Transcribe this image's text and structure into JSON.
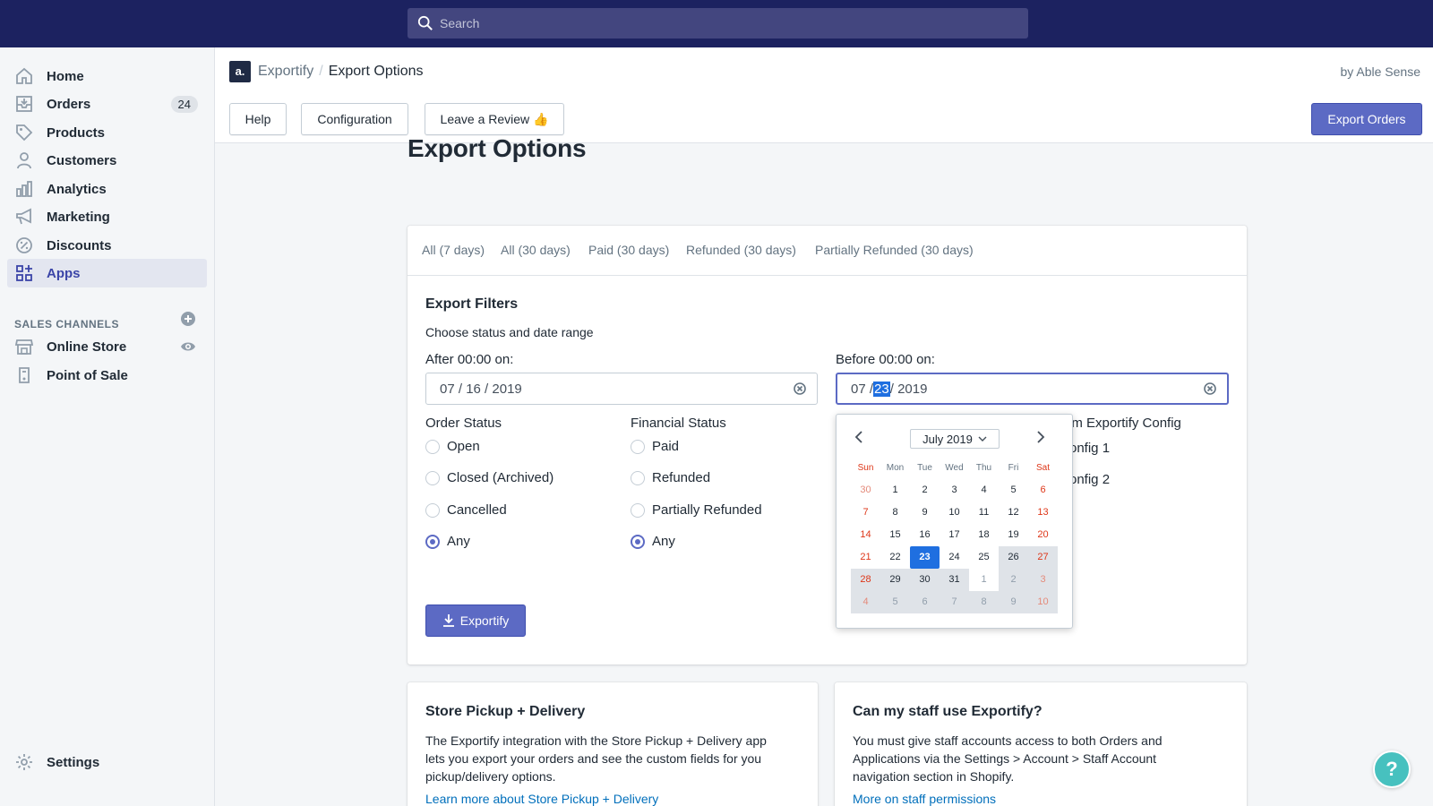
{
  "search": {
    "placeholder": "Search"
  },
  "sidebar": {
    "items": [
      {
        "label": "Home"
      },
      {
        "label": "Orders",
        "badge": "24"
      },
      {
        "label": "Products"
      },
      {
        "label": "Customers"
      },
      {
        "label": "Analytics"
      },
      {
        "label": "Marketing"
      },
      {
        "label": "Discounts"
      },
      {
        "label": "Apps"
      }
    ],
    "sales_channels_title": "SALES CHANNELS",
    "channels": [
      {
        "label": "Online Store"
      },
      {
        "label": "Point of Sale"
      }
    ],
    "settings_label": "Settings"
  },
  "app": {
    "logo": "a.",
    "breadcrumb_app": "Exportify",
    "breadcrumb_sep": "/",
    "breadcrumb_page": "Export Options",
    "byline": "by Able Sense",
    "buttons": {
      "help": "Help",
      "configuration": "Configuration",
      "review": "Leave a Review 👍",
      "export_orders": "Export Orders"
    }
  },
  "page": {
    "title": "Export Options",
    "tabs": [
      "All (7 days)",
      "All (30 days)",
      "Paid (30 days)",
      "Refunded (30 days)",
      "Partially Refunded (30 days)"
    ],
    "filters": {
      "title": "Export Filters",
      "subtitle": "Choose status and date range",
      "after_label": "After 00:00 on:",
      "after_value": {
        "m": "07",
        "d": "16",
        "y": "2019"
      },
      "before_label": "Before 00:00 on:",
      "before_value": {
        "m": "07",
        "d": "23",
        "y": "2019"
      },
      "order_status_title": "Order Status",
      "order_status": [
        "Open",
        "Closed (Archived)",
        "Cancelled",
        "Any"
      ],
      "order_status_selected": "Any",
      "financial_status_title": "Financial Status",
      "financial_status": [
        "Paid",
        "Refunded",
        "Partially Refunded",
        "Any"
      ],
      "financial_status_selected": "Any",
      "config_title_partial": "om Exportify Config",
      "config_items_partial": [
        "onfig 1",
        "onfig 2"
      ],
      "exportify_button": "Exportify"
    },
    "calendar": {
      "month_label": "July 2019",
      "days": [
        "Sun",
        "Mon",
        "Tue",
        "Wed",
        "Thu",
        "Fri",
        "Sat"
      ],
      "weeks": [
        [
          "30",
          "1",
          "2",
          "3",
          "4",
          "5",
          "6"
        ],
        [
          "7",
          "8",
          "9",
          "10",
          "11",
          "12",
          "13"
        ],
        [
          "14",
          "15",
          "16",
          "17",
          "18",
          "19",
          "20"
        ],
        [
          "21",
          "22",
          "23",
          "24",
          "25",
          "26",
          "27"
        ],
        [
          "28",
          "29",
          "30",
          "31",
          "1",
          "2",
          "3"
        ],
        [
          "4",
          "5",
          "6",
          "7",
          "8",
          "9",
          "10"
        ]
      ],
      "selected": "23"
    },
    "cards": [
      {
        "title": "Store Pickup + Delivery",
        "body": [
          "The Exportify integration with the Store Pickup + Delivery app",
          "lets you export your orders and see the custom fields for you",
          "pickup/delivery options."
        ],
        "link": "Learn more about Store Pickup + Delivery"
      },
      {
        "title": "Can my staff use Exportify?",
        "body": [
          "You must give staff accounts access to both Orders and",
          "Applications via the Settings > Account > Staff Account",
          "navigation section in Shopify."
        ],
        "link": "More on staff permissions"
      }
    ]
  },
  "help_button": "?",
  "colors": {
    "topbar": "#1c2260",
    "primary": "#5c6ac4",
    "link": "#006fbb",
    "selected_day": "#1f6fe0"
  }
}
